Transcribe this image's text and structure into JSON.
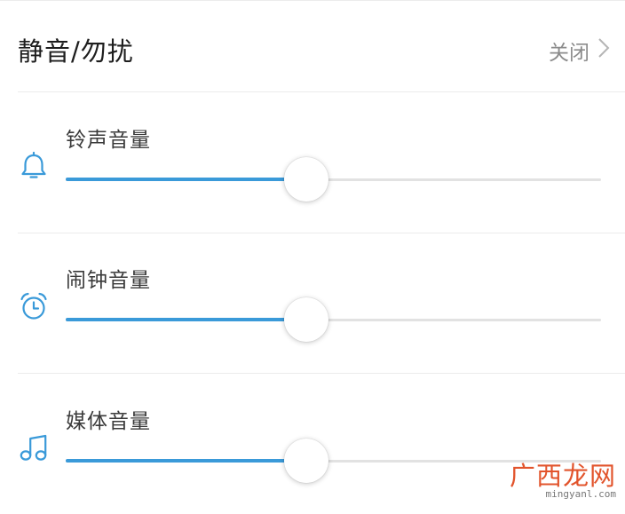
{
  "dnd": {
    "title": "静音/勿扰",
    "value": "关闭"
  },
  "volumes": [
    {
      "label": "铃声音量",
      "icon": "bell-icon",
      "level": 0.45
    },
    {
      "label": "闹钟音量",
      "icon": "alarm-clock-icon",
      "level": 0.45
    },
    {
      "label": "媒体音量",
      "icon": "music-note-icon",
      "level": 0.45
    }
  ],
  "watermark": {
    "text": "广西龙网",
    "url": "mingyanl.com"
  },
  "colors": {
    "accent": "#3a9ad9",
    "track": "#e2e2e2",
    "text": "#1e1e1e",
    "secondary": "#8c8c8c"
  }
}
